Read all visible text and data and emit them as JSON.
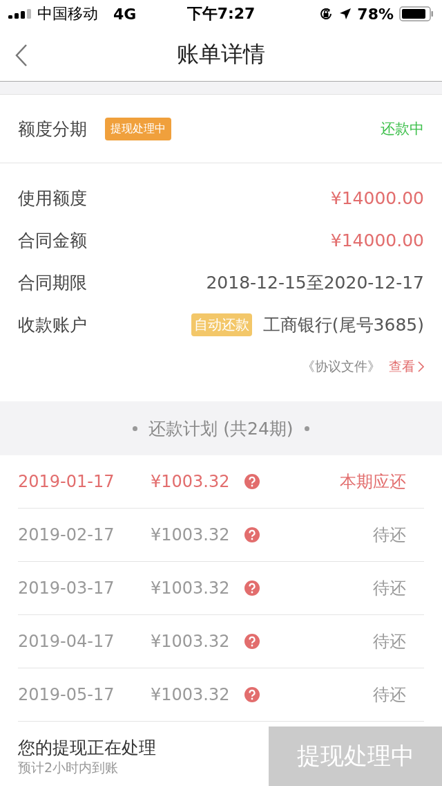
{
  "status_bar": {
    "carrier": "中国移动",
    "network": "4G",
    "time": "下午7:27",
    "battery": "78%"
  },
  "nav": {
    "title": "账单详情"
  },
  "header": {
    "label": "额度分期",
    "badge": "提现处理中",
    "status": "还款中"
  },
  "details": [
    {
      "label": "使用额度",
      "value": "¥14000.00",
      "kind": "amount"
    },
    {
      "label": "合同金额",
      "value": "¥14000.00",
      "kind": "amount"
    },
    {
      "label": "合同期限",
      "value": "2018-12-15至2020-12-17",
      "kind": "plain"
    },
    {
      "label": "收款账户",
      "value": "工商银行(尾号3685)",
      "kind": "account",
      "tag": "自动还款"
    }
  ],
  "agreement": {
    "doc": "《协议文件》",
    "link": "查看"
  },
  "plan": {
    "title": "还款计划 (共24期)",
    "rows": [
      {
        "date": "2019-01-17",
        "amount": "¥1003.32",
        "status": "本期应还",
        "current": true
      },
      {
        "date": "2019-02-17",
        "amount": "¥1003.32",
        "status": "待还",
        "current": false
      },
      {
        "date": "2019-03-17",
        "amount": "¥1003.32",
        "status": "待还",
        "current": false
      },
      {
        "date": "2019-04-17",
        "amount": "¥1003.32",
        "status": "待还",
        "current": false
      },
      {
        "date": "2019-05-17",
        "amount": "¥1003.32",
        "status": "待还",
        "current": false
      }
    ]
  },
  "footer": {
    "title": "您的提现正在处理",
    "subtitle": "预计2小时内到账",
    "button": "提现处理中",
    "disabled": true
  }
}
